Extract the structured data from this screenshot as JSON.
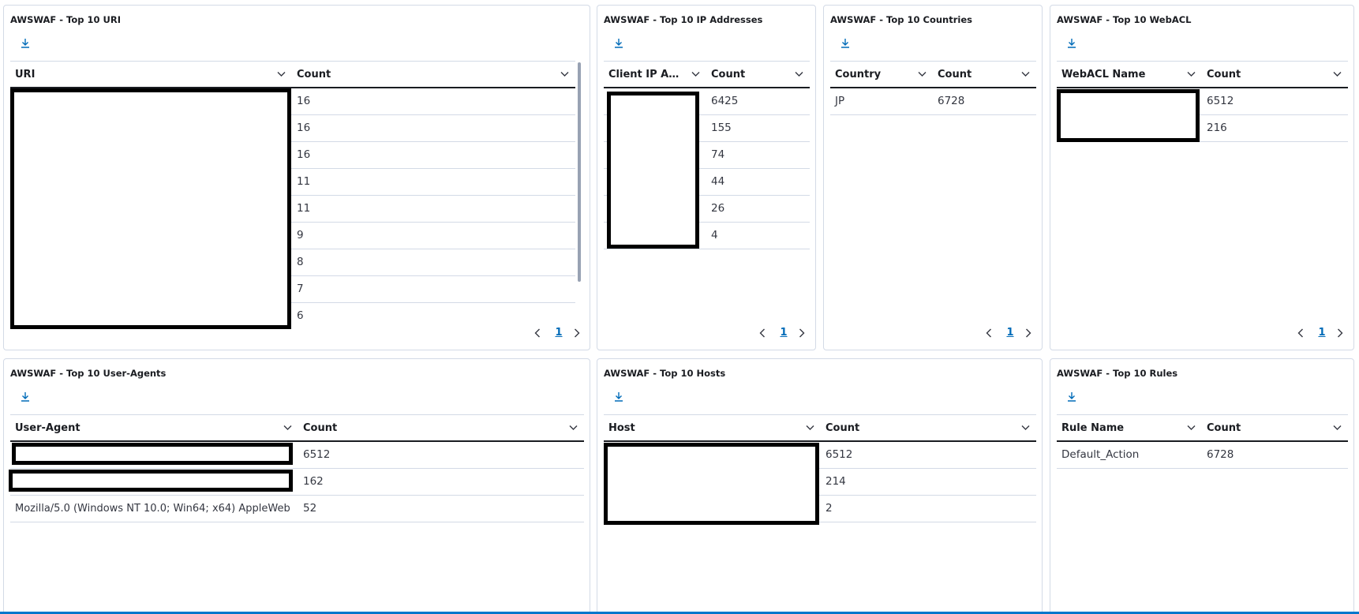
{
  "panels": {
    "uri": {
      "title": "AWSWAF - Top 10 URI",
      "columns": [
        "URI",
        "Count"
      ],
      "counts": [
        "16",
        "16",
        "16",
        "11",
        "11",
        "9",
        "8",
        "7",
        "6"
      ],
      "page": "1"
    },
    "ip": {
      "title": "AWSWAF - Top 10 IP Addresses",
      "columns": [
        "Client IP Add...",
        "Count"
      ],
      "counts": [
        "6425",
        "155",
        "74",
        "44",
        "26",
        "4"
      ],
      "page": "1"
    },
    "countries": {
      "title": "AWSWAF - Top 10 Countries",
      "columns": [
        "Country",
        "Count"
      ],
      "rows": [
        [
          "JP",
          "6728"
        ]
      ],
      "page": "1"
    },
    "webacl": {
      "title": "AWSWAF - Top 10 WebACL",
      "columns": [
        "WebACL Name",
        "Count"
      ],
      "counts": [
        "6512",
        "216"
      ],
      "page": "1"
    },
    "useragents": {
      "title": "AWSWAF - Top 10 User-Agents",
      "columns": [
        "User-Agent",
        "Count"
      ],
      "counts": [
        "6512",
        "162",
        "52"
      ],
      "visible_agent": "Mozilla/5.0 (Windows NT 10.0; Win64; x64) AppleWeb"
    },
    "hosts": {
      "title": "AWSWAF - Top 10 Hosts",
      "columns": [
        "Host",
        "Count"
      ],
      "counts": [
        "6512",
        "214",
        "2"
      ]
    },
    "rules": {
      "title": "AWSWAF - Top 10 Rules",
      "columns": [
        "Rule Name",
        "Count"
      ],
      "rows": [
        [
          "Default_Action",
          "6728"
        ]
      ]
    }
  },
  "icons": {
    "download": "download-icon",
    "sort": "chevron-down-icon",
    "prev": "chevron-left-icon",
    "next": "chevron-right-icon"
  },
  "colors": {
    "accent": "#006bb8",
    "border": "#d3dae6",
    "header_rule": "#1a1c21",
    "redaction": "#000000"
  }
}
